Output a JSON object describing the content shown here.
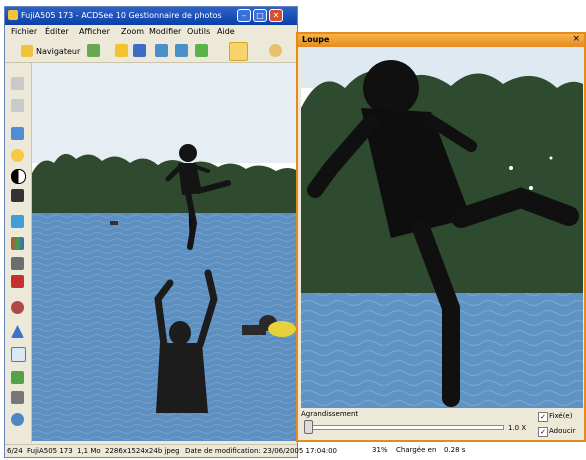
{
  "window": {
    "title": "FujiA505 173 - ACDSee 10 Gestionnaire de photos",
    "controls": {
      "minimize": "–",
      "maximize": "□",
      "close": "✕"
    }
  },
  "menu": [
    "Fichier",
    "Éditer",
    "Afficher",
    "Zoom",
    "Modifier",
    "Outils",
    "Aide"
  ],
  "toolbar": {
    "navigator_label": "Navigateur",
    "icons": [
      "navigator-icon",
      "edit-icon",
      "open-folder-icon",
      "save-icon",
      "rotate-left-icon",
      "rotate-right-icon",
      "pan-hand-icon",
      "zoom-icon"
    ]
  },
  "sidebar": {
    "icons": [
      "cut-icon",
      "crop-icon",
      "exposure-icon",
      "brightness-icon",
      "contrast-icon",
      "levels-icon",
      "color-icon",
      "histogram-icon",
      "sharpen-icon",
      "noise-icon",
      "red-eye-icon",
      "straighten-icon",
      "resize-icon",
      "effects-icon",
      "photo-repair-icon",
      "undo-icon"
    ]
  },
  "status": {
    "index": "6/24",
    "filename": "FujiA505 173",
    "size": "1,1 Mo",
    "dimensions": "2286x1524x24b jpeg",
    "modified": "Date de modification: 23/06/2005 17:04:00",
    "zoom": "31%",
    "loaded": "Chargée en",
    "load_time": "0.28 s"
  },
  "loupe": {
    "title": "Loupe",
    "close": "×",
    "magnification_label": "Agrandissement",
    "zoom_value": "1.0 X",
    "slider_level": 0,
    "fixed_label": "Fixé(e)",
    "fixed_checked": true,
    "smooth_label": "Adoucir",
    "smooth_checked": true,
    "check_mark": "✓"
  },
  "colors": {
    "title_blue": "#0b3fa8",
    "loupe_orange": "#e58a1f",
    "sky": "#d9e6ef",
    "water": "#5d8fc0",
    "trees": "#2f4a2e"
  }
}
